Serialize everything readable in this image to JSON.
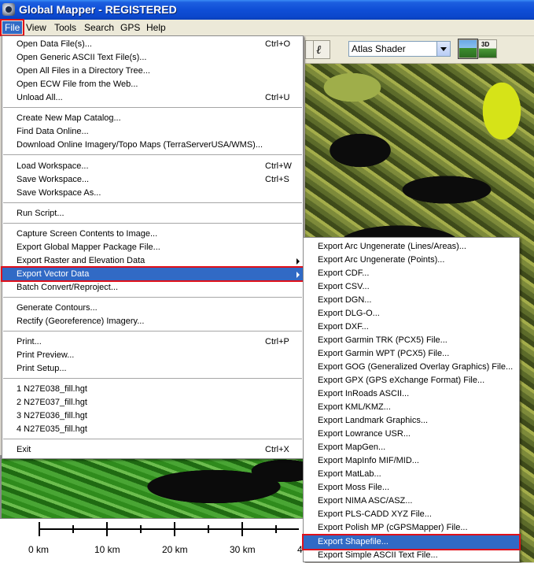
{
  "window": {
    "title": "Global Mapper - REGISTERED"
  },
  "menubar": {
    "items": [
      "File",
      "View",
      "Tools",
      "Search",
      "GPS",
      "Help"
    ]
  },
  "toolbar": {
    "shader_value": "Atlas Shader",
    "threed_label": "3D",
    "pen_glyph": "ℓ"
  },
  "file_menu": {
    "items": [
      {
        "label": "Open Data File(s)...",
        "shortcut": "Ctrl+O"
      },
      {
        "label": "Open Generic ASCII Text File(s)...",
        "shortcut": ""
      },
      {
        "label": "Open All Files in a Directory Tree...",
        "shortcut": ""
      },
      {
        "label": "Open ECW File from the Web...",
        "shortcut": ""
      },
      {
        "label": "Unload All...",
        "shortcut": "Ctrl+U"
      },
      {
        "label": "Create New Map Catalog...",
        "shortcut": ""
      },
      {
        "label": "Find Data Online...",
        "shortcut": ""
      },
      {
        "label": "Download Online Imagery/Topo Maps (TerraServerUSA/WMS)...",
        "shortcut": ""
      },
      {
        "label": "Load Workspace...",
        "shortcut": "Ctrl+W"
      },
      {
        "label": "Save Workspace...",
        "shortcut": "Ctrl+S"
      },
      {
        "label": "Save Workspace As...",
        "shortcut": ""
      },
      {
        "label": "Run Script...",
        "shortcut": ""
      },
      {
        "label": "Capture Screen Contents to Image...",
        "shortcut": ""
      },
      {
        "label": "Export Global Mapper Package File...",
        "shortcut": ""
      },
      {
        "label": "Export Raster and Elevation Data",
        "shortcut": ""
      },
      {
        "label": "Export Vector Data",
        "shortcut": ""
      },
      {
        "label": "Batch Convert/Reproject...",
        "shortcut": ""
      },
      {
        "label": "Generate Contours...",
        "shortcut": ""
      },
      {
        "label": "Rectify (Georeference) Imagery...",
        "shortcut": ""
      },
      {
        "label": "Print...",
        "shortcut": "Ctrl+P"
      },
      {
        "label": "Print Preview...",
        "shortcut": ""
      },
      {
        "label": "Print Setup...",
        "shortcut": ""
      },
      {
        "label": "1 N27E038_fill.hgt",
        "shortcut": ""
      },
      {
        "label": "2 N27E037_fill.hgt",
        "shortcut": ""
      },
      {
        "label": "3 N27E036_fill.hgt",
        "shortcut": ""
      },
      {
        "label": "4 N27E035_fill.hgt",
        "shortcut": ""
      },
      {
        "label": "Exit",
        "shortcut": "Ctrl+X"
      }
    ]
  },
  "vector_submenu": {
    "items": [
      "Export Arc Ungenerate (Lines/Areas)...",
      "Export Arc Ungenerate (Points)...",
      "Export CDF...",
      "Export CSV...",
      "Export DGN...",
      "Export DLG-O...",
      "Export DXF...",
      "Export Garmin TRK (PCX5) File...",
      "Export Garmin WPT (PCX5) File...",
      "Export GOG (Generalized Overlay Graphics) File...",
      "Export GPX (GPS eXchange Format) File...",
      "Export InRoads ASCII...",
      "Export KML/KMZ...",
      "Export Landmark Graphics...",
      "Export Lowrance USR...",
      "Export MapGen...",
      "Export MapInfo MIF/MID...",
      "Export MatLab...",
      "Export Moss File...",
      "Export NIMA ASC/ASZ...",
      "Export PLS-CADD XYZ File...",
      "Export Polish MP (cGPSMapper) File...",
      "Export Shapefile...",
      "Export Simple ASCII Text File..."
    ]
  },
  "scale": {
    "labels": [
      "0 km",
      "10 km",
      "20 km",
      "30 km",
      "4"
    ]
  }
}
